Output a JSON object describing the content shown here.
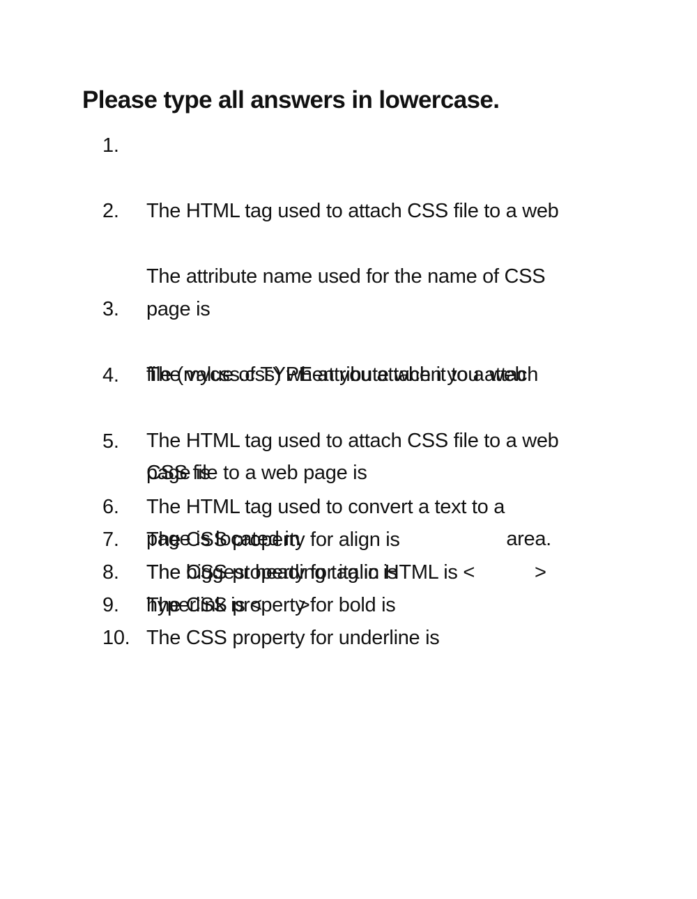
{
  "title": "Please type all answers in lowercase.",
  "questions": [
    {
      "number": "1.",
      "lines": [
        "The HTML tag used to attach CSS file to a web",
        "page is"
      ]
    },
    {
      "number": "2.",
      "lines": [
        "The attribute name used for the name of CSS",
        "file (mycss.css) when you attach it to a web",
        "page is"
      ]
    },
    {
      "number": "3.",
      "lines": [
        "The value of TYPE attribute when you attach",
        "CSS file to a web page is"
      ]
    },
    {
      "number": "4.",
      "lines": [
        "The HTML tag used to attach CSS file to a web",
        "page is located in"
      ],
      "suffix": "area."
    },
    {
      "number": "5.",
      "lines": [
        "The HTML tag used to convert a text to a",
        "hyperlink is"
      ],
      "open": "<",
      "close": ">"
    },
    {
      "number": "6.",
      "lines": [
        "The biggest heading tag in HTML is"
      ],
      "open": "<",
      "close": ">"
    },
    {
      "number": "7.",
      "lines": [
        "The CSS property for align is"
      ]
    },
    {
      "number": "8.",
      "lines": [
        "The CSS property for italic is"
      ]
    },
    {
      "number": "9.",
      "lines": [
        "The CSS property for bold is"
      ]
    },
    {
      "number": "10.",
      "lines": [
        "The CSS property for underline is"
      ]
    }
  ]
}
